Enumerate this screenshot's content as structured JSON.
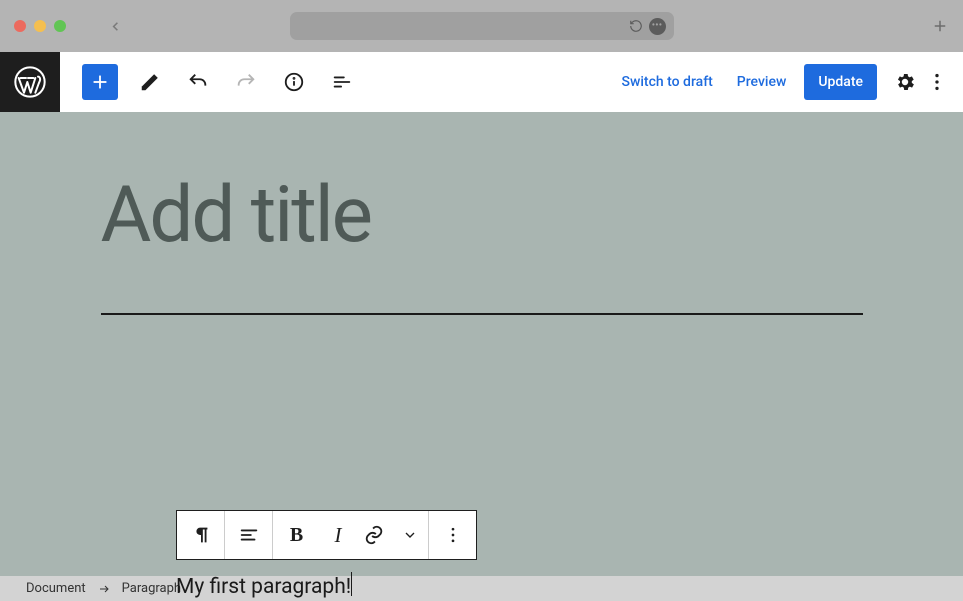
{
  "header": {
    "switch_draft": "Switch to draft",
    "preview": "Preview",
    "update": "Update"
  },
  "editor": {
    "title_placeholder": "Add title",
    "paragraph": "My first paragraph!"
  },
  "breadcrumb": {
    "root": "Document",
    "current": "Paragraph"
  }
}
